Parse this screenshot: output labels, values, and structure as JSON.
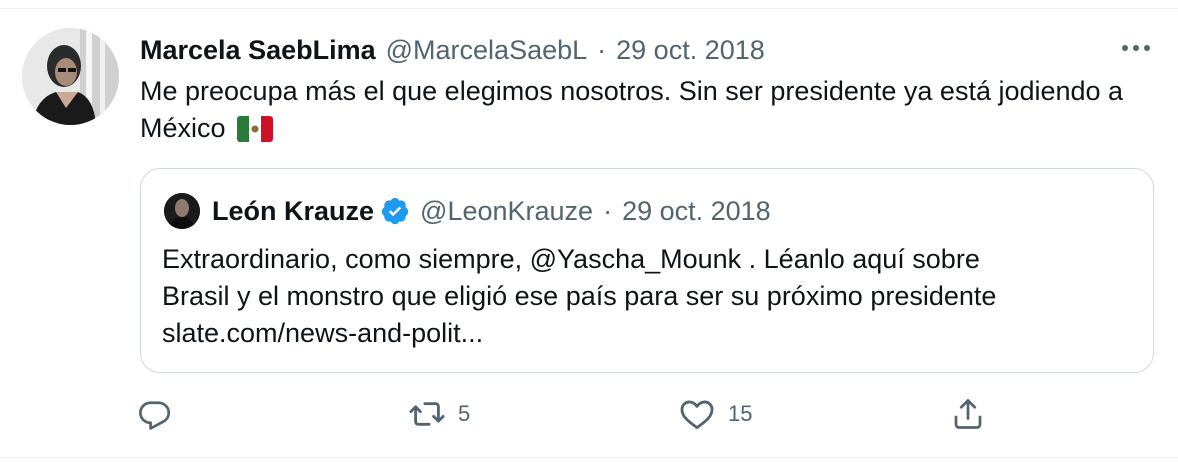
{
  "tweet": {
    "author_name": "Marcela SaebLima",
    "handle": "@MarcelaSaebL",
    "separator": "·",
    "date": "29 oct. 2018",
    "text": "Me preocupa más el que elegimos nosotros. Sin ser presidente ya está jodiendo a México",
    "flag_icon": "mexico-flag-icon"
  },
  "quoted_tweet": {
    "author_name": "León Krauze",
    "verified": true,
    "handle": "@LeonKrauze",
    "separator": "·",
    "date": "29 oct. 2018",
    "text_lines": [
      "Extraordinario, como siempre, @Yascha_Mounk . Léanlo aquí sobre",
      "Brasil y el monstro que eligió ese país para ser su próximo presidente",
      "slate.com/news-and-polit..."
    ]
  },
  "actions": {
    "reply_count": "",
    "retweet_count": "5",
    "like_count": "15"
  },
  "colors": {
    "text_primary": "#0f1419",
    "text_secondary": "#536471",
    "border": "#cfd9de",
    "verified_blue": "#1d9bf0"
  }
}
